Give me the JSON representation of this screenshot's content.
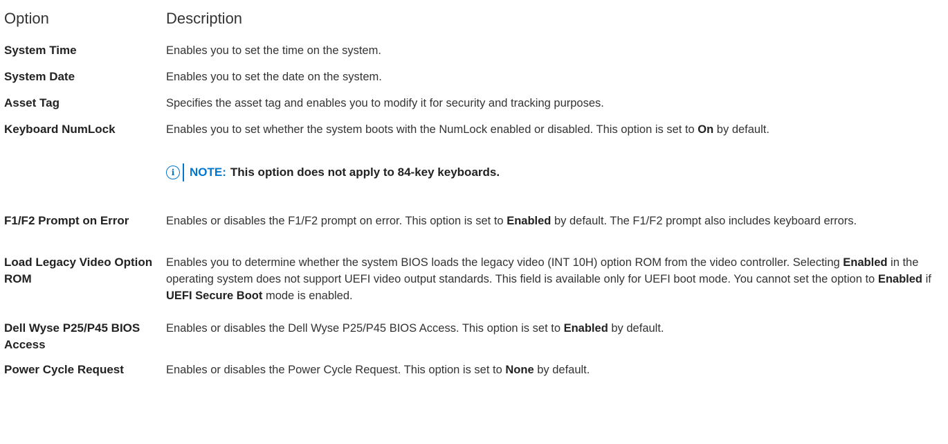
{
  "header": {
    "option": "Option",
    "description": "Description"
  },
  "rows": [
    {
      "option": "System Time",
      "description": "Enables you to set the time on the system."
    },
    {
      "option": "System Date",
      "description": "Enables you to set the date on the system."
    },
    {
      "option": "Asset Tag",
      "description": "Specifies the asset tag and enables you to modify it for security and tracking purposes."
    },
    {
      "option": "Keyboard NumLock",
      "desc_pre": "Enables you to set whether the system boots with the NumLock enabled or disabled. This option is set to ",
      "desc_bold": "On",
      "desc_post": " by default."
    },
    {
      "option": "F1/F2 Prompt on Error",
      "desc_pre": "Enables or disables the F1/F2 prompt on error. This option is set to ",
      "desc_bold": "Enabled",
      "desc_post": " by default. The F1/F2 prompt also includes keyboard errors."
    },
    {
      "option": "Load Legacy Video Option ROM",
      "desc_pre": "Enables you to determine whether the system BIOS loads the legacy video (INT 10H) option ROM from the video controller. Selecting ",
      "desc_bold": "Enabled",
      "desc_mid": " in the operating system does not support UEFI video output standards. This field is available only for UEFI boot mode. You cannot set the option to ",
      "desc_bold2": "Enabled",
      "desc_mid2": " if ",
      "desc_bold3": "UEFI Secure Boot",
      "desc_post": " mode is enabled."
    },
    {
      "option": "Dell Wyse P25/P45 BIOS Access",
      "desc_pre": "Enables or disables the Dell Wyse P25/P45 BIOS Access. This option is set to ",
      "desc_bold": "Enabled",
      "desc_post": " by default."
    },
    {
      "option": "Power Cycle Request",
      "desc_pre": "Enables or disables the Power Cycle Request. This option is set to ",
      "desc_bold": "None",
      "desc_post": " by default."
    }
  ],
  "note": {
    "icon": "info-icon",
    "label": "NOTE:",
    "text": "This option does not apply to 84-key keyboards."
  },
  "colors": {
    "accent": "#0076ce",
    "text": "#222222"
  }
}
